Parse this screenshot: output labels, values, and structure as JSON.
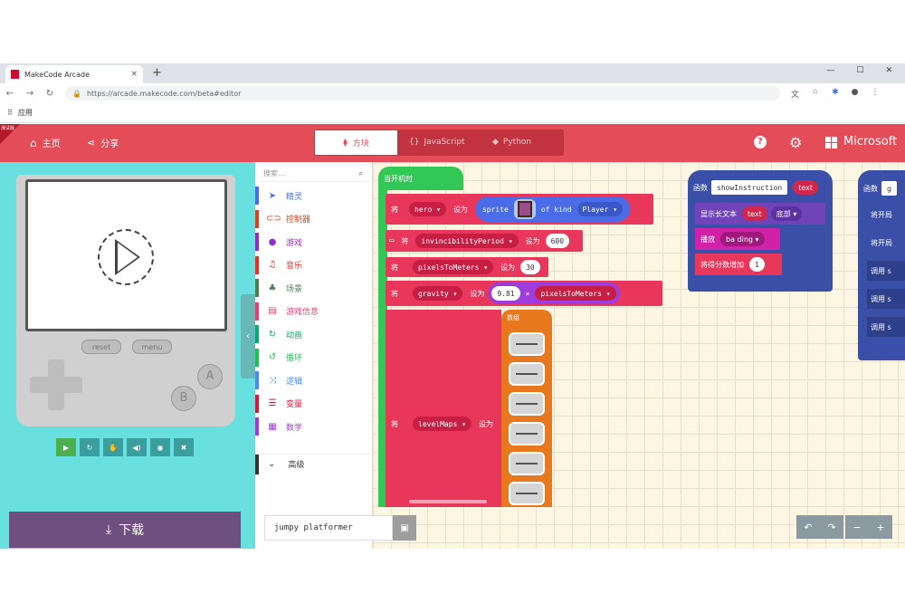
{
  "browser": {
    "tab_title": "MakeCode Arcade",
    "tab_close": "×",
    "new_tab": "+",
    "url": "https://arcade.makecode.com/beta#editor",
    "bookmarks_label": "应用",
    "window_controls": [
      "—",
      "☐",
      "✕"
    ]
  },
  "header": {
    "corner_label": "测试版",
    "home_label": "主页",
    "share_label": "分享",
    "mode_blocks": "方块",
    "mode_js": "JavaScript",
    "mode_python": "Python",
    "brand": "Microsoft",
    "help": "?"
  },
  "simulator": {
    "reset_label": "reset",
    "menu_label": "menu",
    "a_label": "A",
    "b_label": "B",
    "download_label": "下载"
  },
  "toolbox": {
    "search_placeholder": "搜索...",
    "items": [
      {
        "label": "精灵",
        "color": "#4b6ce8",
        "icon": "➤"
      },
      {
        "label": "控制器",
        "color": "#d54322",
        "icon": "⊂⊃"
      },
      {
        "label": "游戏",
        "color": "#8e2ec4",
        "icon": "●"
      },
      {
        "label": "音乐",
        "color": "#e63022",
        "icon": "♫"
      },
      {
        "label": "场景",
        "color": "#4b7e53",
        "icon": "♣"
      },
      {
        "label": "游戏信息",
        "color": "#e83d6f",
        "icon": "▤"
      },
      {
        "label": "动画",
        "color": "#03aa74",
        "icon": "↻"
      },
      {
        "label": "循环",
        "color": "#20bf55",
        "icon": "↺"
      },
      {
        "label": "逻辑",
        "color": "#478bf5",
        "icon": "⤨"
      },
      {
        "label": "变量",
        "color": "#dc143c",
        "icon": "☰"
      },
      {
        "label": "数学",
        "color": "#9f3cdc",
        "icon": "▦"
      }
    ],
    "advanced_label": "高级"
  },
  "workspace": {
    "start_label": "当开机时",
    "set_word": "将",
    "to_word": "设为",
    "hero_var": "hero",
    "sprite_label": "sprite",
    "of_kind": "of kind",
    "kind_player": "Player",
    "invincibility_var": "invincibilityPeriod",
    "invincibility_val": "600",
    "pixels_var": "pixelsToMeters",
    "pixels_val": "30",
    "gravity_var": "gravity",
    "gravity_val": "9.81",
    "times_op": "×",
    "levelmaps_var": "levelMaps",
    "array_label": "数组",
    "func1_label": "函数",
    "func1_name": "showInstruction",
    "func1_param": "text",
    "func1_line1_a": "显示长文本",
    "func1_line1_param": "text",
    "func1_line1_b": "底部",
    "func1_line2_a": "播放",
    "func1_line2_b": "ba ding",
    "func1_line3": "将得分数增加",
    "func1_line3_val": "1",
    "func2_label": "函数",
    "func2_name": "g",
    "func2_lines": [
      "将开局",
      "将开局",
      "调用 s",
      "调用 s",
      "调用 s"
    ],
    "project_name": "jumpy platformer"
  }
}
